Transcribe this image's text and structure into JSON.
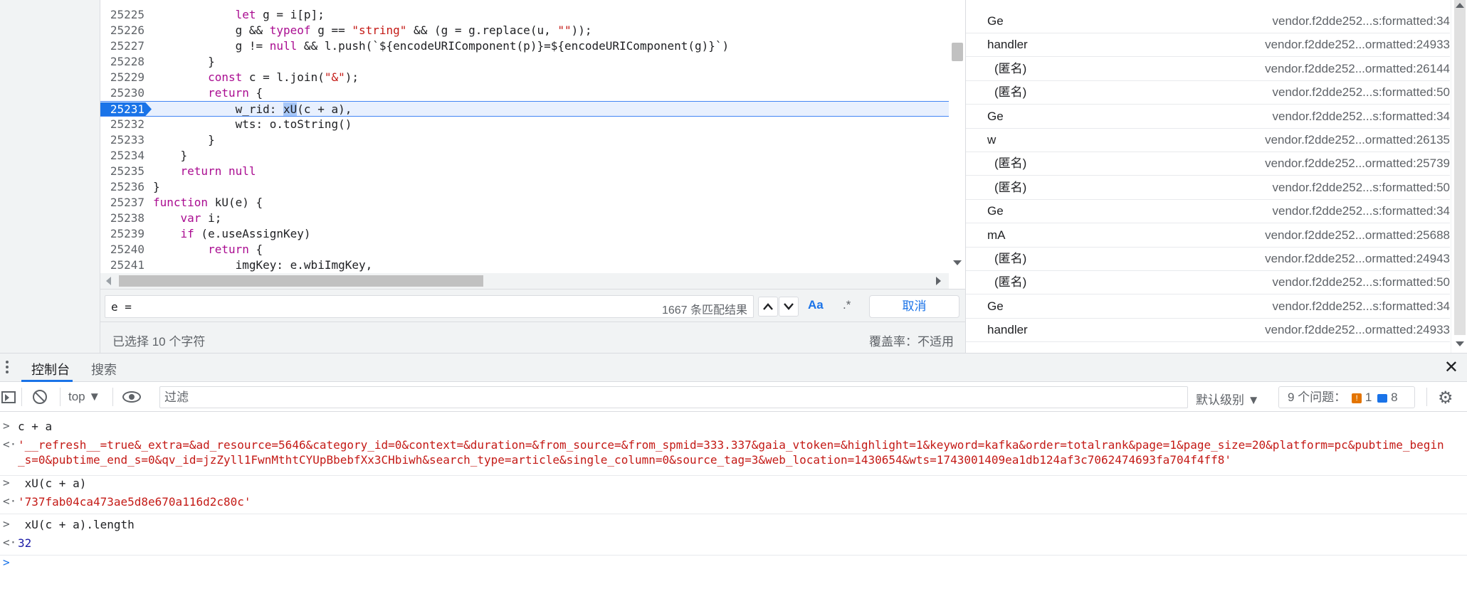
{
  "editor": {
    "lines": [
      {
        "n": "25225",
        "parts": [
          [
            "",
            "            "
          ],
          [
            "kw",
            "let"
          ],
          [
            "",
            " g = i[p];"
          ]
        ]
      },
      {
        "n": "25226",
        "parts": [
          [
            "",
            "            g && "
          ],
          [
            "kw",
            "typeof"
          ],
          [
            "",
            " g == "
          ],
          [
            "str",
            "\"string\""
          ],
          [
            "",
            " && (g = g.replace(u, "
          ],
          [
            "str",
            "\"\""
          ],
          [
            "",
            "));"
          ]
        ]
      },
      {
        "n": "25227",
        "parts": [
          [
            "",
            "            g != "
          ],
          [
            "nul",
            "null"
          ],
          [
            "",
            " && l.push(`${encodeURIComponent(p)}=${encodeURIComponent(g)}`)"
          ]
        ]
      },
      {
        "n": "25228",
        "parts": [
          [
            "",
            "        }"
          ]
        ]
      },
      {
        "n": "25229",
        "parts": [
          [
            "",
            "        "
          ],
          [
            "kw",
            "const"
          ],
          [
            "",
            " c = l.join("
          ],
          [
            "str",
            "\"&\""
          ],
          [
            "",
            ");"
          ]
        ]
      },
      {
        "n": "25230",
        "parts": [
          [
            "",
            "        "
          ],
          [
            "kw",
            "return"
          ],
          [
            "",
            " {"
          ]
        ]
      },
      {
        "n": "25231",
        "active": true,
        "parts": [
          [
            "",
            "            w_rid: "
          ],
          [
            "sel",
            "xU"
          ],
          [
            "",
            "(c + a),"
          ]
        ]
      },
      {
        "n": "25232",
        "parts": [
          [
            "",
            "            wts: o.toString()"
          ]
        ]
      },
      {
        "n": "25233",
        "parts": [
          [
            "",
            "        }"
          ]
        ]
      },
      {
        "n": "25234",
        "parts": [
          [
            "",
            "    }"
          ]
        ]
      },
      {
        "n": "25235",
        "parts": [
          [
            "",
            "    "
          ],
          [
            "kw",
            "return"
          ],
          [
            "",
            " "
          ],
          [
            "nul",
            "null"
          ]
        ]
      },
      {
        "n": "25236",
        "parts": [
          [
            "",
            "}"
          ]
        ]
      },
      {
        "n": "25237",
        "parts": [
          [
            "kw",
            "function"
          ],
          [
            "",
            " kU(e) {"
          ]
        ]
      },
      {
        "n": "25238",
        "parts": [
          [
            "",
            "    "
          ],
          [
            "kw",
            "var"
          ],
          [
            "",
            " i;"
          ]
        ]
      },
      {
        "n": "25239",
        "parts": [
          [
            "",
            "    "
          ],
          [
            "kw",
            "if"
          ],
          [
            "",
            " (e.useAssignKey)"
          ]
        ]
      },
      {
        "n": "25240",
        "parts": [
          [
            "",
            "        "
          ],
          [
            "kw",
            "return"
          ],
          [
            "",
            " {"
          ]
        ]
      },
      {
        "n": "25241",
        "parts": [
          [
            "",
            "            imgKey: e.wbiImgKey,"
          ]
        ]
      }
    ]
  },
  "search": {
    "value": "e =",
    "match_count": "1667 条匹配结果",
    "case_label": "Aa",
    "regex_label": ".*",
    "cancel_label": "取消"
  },
  "status": {
    "selection": "已选择 10 个字符",
    "coverage": "覆盖率：不适用"
  },
  "callstack": {
    "frames": [
      {
        "name": "Ge",
        "loc": "vendor.f2dde252...s:formatted:34"
      },
      {
        "name": "handler",
        "loc": "vendor.f2dde252...ormatted:24933"
      },
      {
        "name": "(匿名)",
        "loc": "vendor.f2dde252...ormatted:26144",
        "anon": true
      },
      {
        "name": "(匿名)",
        "loc": "vendor.f2dde252...s:formatted:50",
        "anon": true
      },
      {
        "name": "Ge",
        "loc": "vendor.f2dde252...s:formatted:34"
      },
      {
        "name": "w",
        "loc": "vendor.f2dde252...ormatted:26135"
      },
      {
        "name": "(匿名)",
        "loc": "vendor.f2dde252...ormatted:25739",
        "anon": true
      },
      {
        "name": "(匿名)",
        "loc": "vendor.f2dde252...s:formatted:50",
        "anon": true
      },
      {
        "name": "Ge",
        "loc": "vendor.f2dde252...s:formatted:34"
      },
      {
        "name": "mA",
        "loc": "vendor.f2dde252...ormatted:25688"
      },
      {
        "name": "(匿名)",
        "loc": "vendor.f2dde252...ormatted:24943",
        "anon": true
      },
      {
        "name": "(匿名)",
        "loc": "vendor.f2dde252...s:formatted:50",
        "anon": true
      },
      {
        "name": "Ge",
        "loc": "vendor.f2dde252...s:formatted:34"
      },
      {
        "name": "handler",
        "loc": "vendor.f2dde252...ormatted:24933"
      }
    ]
  },
  "drawer": {
    "tab_console": "控制台",
    "tab_search": "搜索",
    "close": "✕"
  },
  "toolbar": {
    "context": "top ▼",
    "filter_placeholder": "过滤",
    "level": "默认级别 ▼",
    "issues_label": "9 个问题：",
    "issues_warn": "1",
    "issues_info": "8",
    "gear": "⚙"
  },
  "console": {
    "rows": [
      {
        "prefix": ">",
        "text": "c + a",
        "kind": "input"
      },
      {
        "prefix": "<·",
        "text": "'__refresh__=true&_extra=&ad_resource=5646&category_id=0&context=&duration=&from_source=&from_spmid=333.337&gaia_vtoken=&highlight=1&keyword=kafka&order=totalrank&page=1&page_size=20&platform=pc&pubtime_begin_s=0&pubtime_end_s=0&qv_id=jzZyll1FwnMthtCYUpBbebfXx3CHbiwh&search_type=article&single_column=0&source_tag=3&web_location=1430654&wts=1743001409ea1db124af3c7062474693fa704f4ff8'",
        "kind": "str"
      },
      {
        "prefix": ">",
        "text": " xU(c + a)",
        "kind": "input"
      },
      {
        "prefix": "<·",
        "text": "'737fab04ca473ae5d8e670a116d2c80c'",
        "kind": "str"
      },
      {
        "prefix": ">",
        "text": " xU(c + a).length",
        "kind": "input"
      },
      {
        "prefix": "<·",
        "text": "32",
        "kind": "num"
      },
      {
        "prefix": ">",
        "text": "",
        "kind": "prompt"
      }
    ]
  }
}
